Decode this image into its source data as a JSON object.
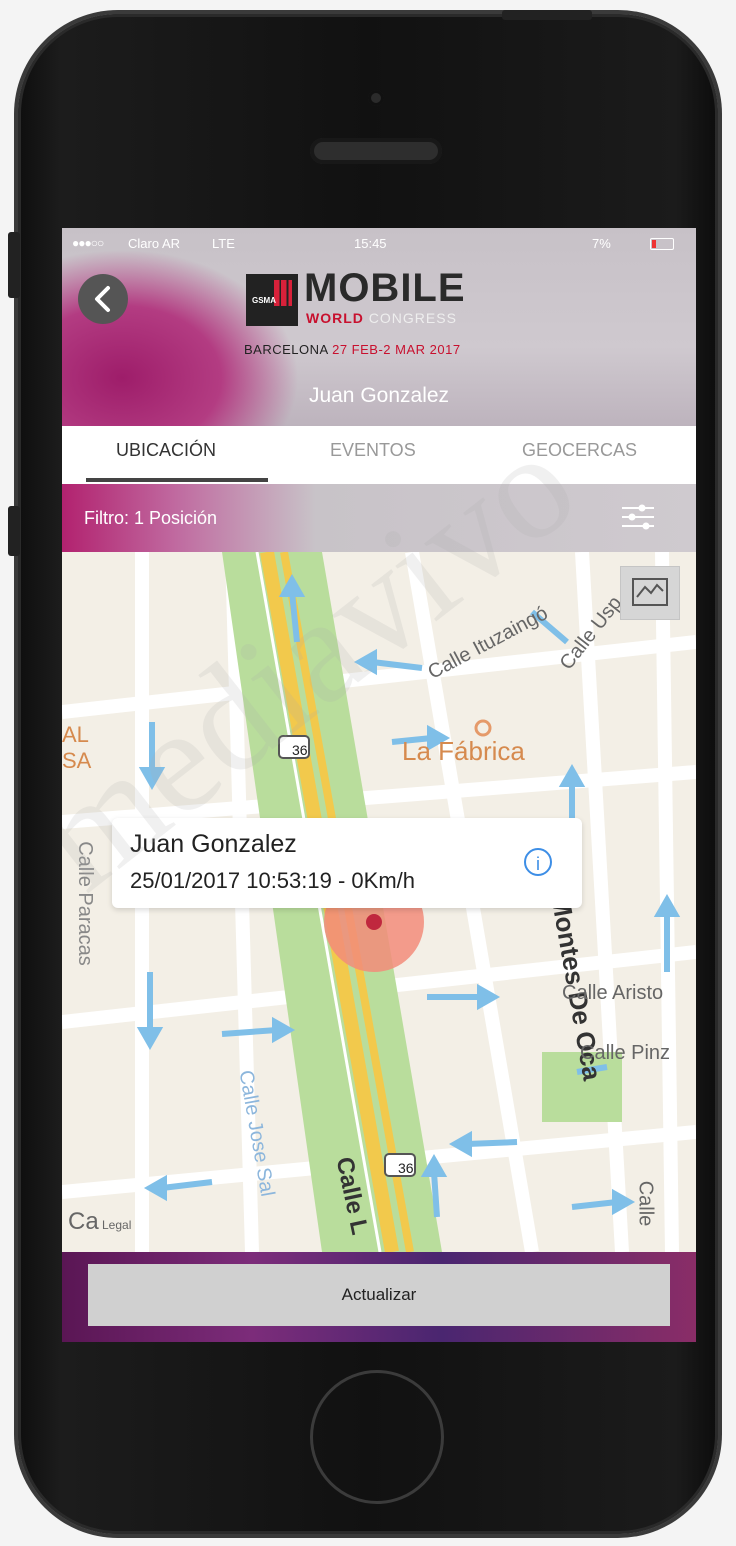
{
  "status_bar": {
    "signal": "●●●○○",
    "carrier": "Claro AR",
    "network": "LTE",
    "time": "15:45",
    "battery": "7%"
  },
  "header": {
    "logo_main": "MOBILE",
    "logo_world": "WORLD",
    "logo_congress": "CONGRESS",
    "logo_gsma": "GSMA",
    "logo_city": "BARCELONA",
    "logo_dates": "27 FEB-2 MAR 2017",
    "user_name": "Juan Gonzalez"
  },
  "tabs": [
    {
      "label": "UBICACIÓN",
      "active": true
    },
    {
      "label": "EVENTOS",
      "active": false
    },
    {
      "label": "GEOCERCAS",
      "active": false
    }
  ],
  "filter": {
    "label": "Filtro: 1 Posición"
  },
  "map": {
    "labels": {
      "calle_ituzaingo": "Calle Ituzaingó",
      "calle_uspallata": "Calle Usp",
      "la_fabrica": "La Fábrica",
      "calle_paracas": "Calle Paracas",
      "montes_de_oca": "Montes De Oca",
      "calle_aristobulo": "Calle Aristo",
      "calle_pinzon": "Calle Pinz",
      "calle_jose_sal": "Calle Jose Sal",
      "calle_bottom": "Calle L",
      "calle_right": "Calle",
      "ca_left": "Ca",
      "al": "AL",
      "sa": "SA",
      "route_top": "36",
      "route_bottom": "36",
      "legal": "Legal"
    },
    "callout": {
      "name": "Juan Gonzalez",
      "detail": "25/01/2017 10:53:19 - 0Km/h"
    }
  },
  "actions": {
    "update_label": "Actualizar"
  },
  "colors": {
    "accent": "#b2226f",
    "tab_active": "#333333",
    "info": "#3d8ee6",
    "marker": "#e8714a"
  }
}
